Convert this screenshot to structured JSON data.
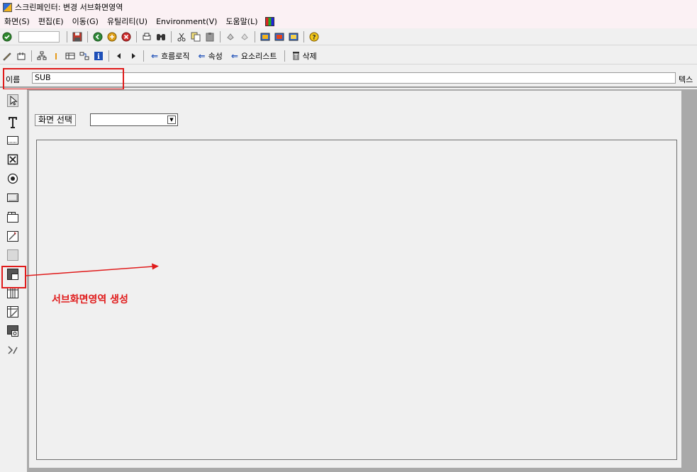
{
  "window": {
    "title": "스크린페인터: 변경 서브화면영역",
    "app_icon": "screen-painter-icon"
  },
  "menubar": {
    "items": [
      "화면(S)",
      "편집(E)",
      "이동(G)",
      "유틸리티(U)",
      "Environment(V)",
      "도움말(L)"
    ]
  },
  "toolbar2": {
    "flow_logic": "흐름로직",
    "attributes": "속성",
    "element_list": "요소리스트",
    "delete": "삭제"
  },
  "name_field": {
    "label": "이름",
    "value": "SUB",
    "right_label": "텍스"
  },
  "canvas": {
    "screen_select_label": "화면 선택",
    "screen_select_value": ""
  },
  "annotation": {
    "text": "서브화면영역 생성",
    "color": "#e01b1b"
  },
  "palette": [
    "select-pointer-icon",
    "text-field-icon",
    "input-field-icon",
    "checkbox-icon",
    "radio-button-icon",
    "pushbutton-icon",
    "tabstrip-icon",
    "tabstrip-wizard-icon",
    "box-icon",
    "subscreen-area-icon",
    "table-control-icon",
    "table-control-wizard-icon",
    "custom-control-icon",
    "status-icon"
  ]
}
